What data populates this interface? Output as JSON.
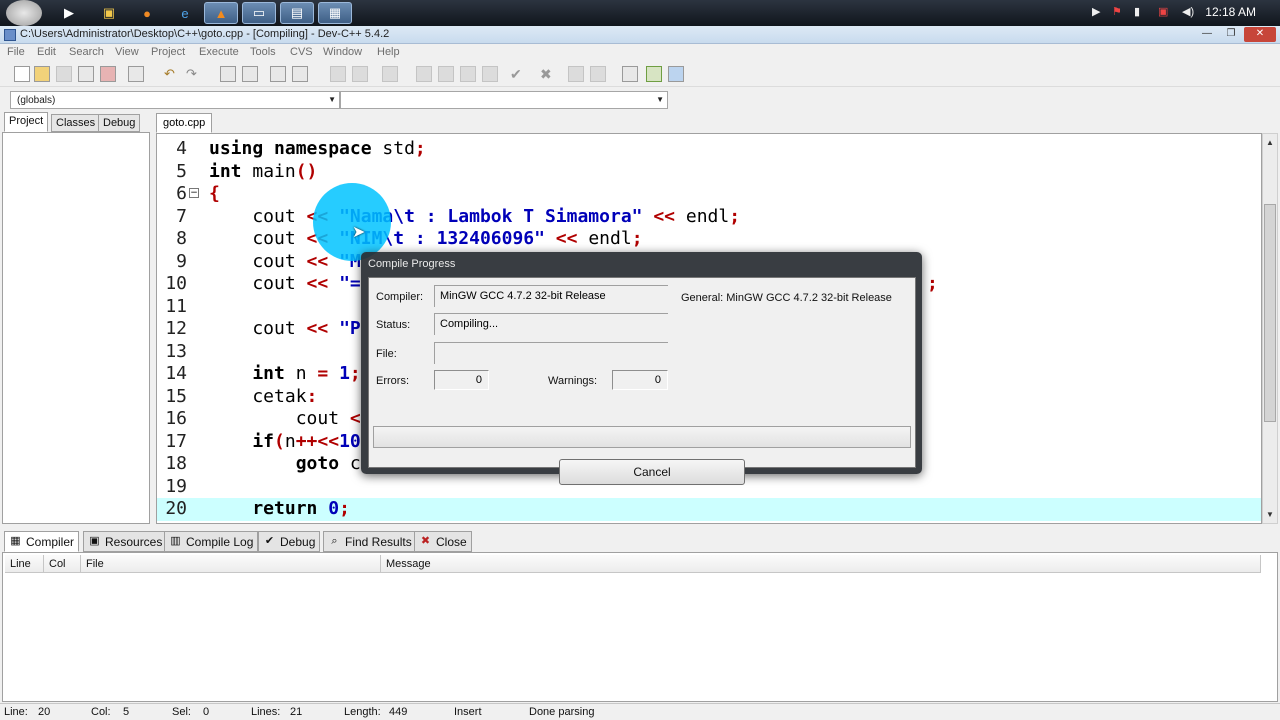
{
  "taskbar": {
    "clock": "12:18 AM",
    "buttons": [
      "start-orb",
      "media-player",
      "file-explorer",
      "firefox",
      "ie",
      "vlc",
      "window-a",
      "window-b",
      "devcpp"
    ]
  },
  "window": {
    "title": "C:\\Users\\Administrator\\Desktop\\C++\\goto.cpp - [Compiling] - Dev-C++ 5.4.2"
  },
  "menu": [
    "File",
    "Edit",
    "Search",
    "View",
    "Project",
    "Execute",
    "Tools",
    "CVS",
    "Window",
    "Help"
  ],
  "combos": {
    "scope": "(globals)",
    "members": ""
  },
  "left_tabs": [
    "Project",
    "Classes",
    "Debug"
  ],
  "editor": {
    "file_tab": "goto.cpp",
    "lines": [
      {
        "n": "4",
        "fold": false,
        "hl": false,
        "parts": [
          [
            "kw",
            "using namespace "
          ],
          [
            "id",
            "std"
          ],
          [
            "op",
            ";"
          ]
        ]
      },
      {
        "n": "5",
        "fold": false,
        "hl": false,
        "parts": [
          [
            "kw",
            "int "
          ],
          [
            "id",
            "main"
          ],
          [
            "op",
            "()"
          ]
        ]
      },
      {
        "n": "6",
        "fold": true,
        "hl": false,
        "parts": [
          [
            "op",
            "{"
          ]
        ]
      },
      {
        "n": "7",
        "fold": false,
        "hl": false,
        "parts": [
          [
            "id",
            "    cout "
          ],
          [
            "op",
            "<< "
          ],
          [
            "str",
            "\"Nama\\t : Lambok T Simamora\""
          ],
          [
            "op",
            " << "
          ],
          [
            "id",
            "endl"
          ],
          [
            "op",
            ";"
          ]
        ]
      },
      {
        "n": "8",
        "fold": false,
        "hl": false,
        "parts": [
          [
            "id",
            "    cout "
          ],
          [
            "op",
            "<< "
          ],
          [
            "str",
            "\"NIM\\t : 132406096\""
          ],
          [
            "op",
            " << "
          ],
          [
            "id",
            "endl"
          ],
          [
            "op",
            ";"
          ]
        ]
      },
      {
        "n": "9",
        "fold": false,
        "hl": false,
        "parts": [
          [
            "id",
            "    cout "
          ],
          [
            "op",
            "<< "
          ],
          [
            "str",
            "\"M"
          ]
        ]
      },
      {
        "n": "10",
        "fold": false,
        "hl": false,
        "parts": [
          [
            "id",
            "    cout "
          ],
          [
            "op",
            "<< "
          ],
          [
            "str",
            "\"="
          ]
        ]
      },
      {
        "n": "11",
        "fold": false,
        "hl": false,
        "parts": []
      },
      {
        "n": "12",
        "fold": false,
        "hl": false,
        "parts": [
          [
            "id",
            "    cout "
          ],
          [
            "op",
            "<< "
          ],
          [
            "str",
            "\"P"
          ]
        ]
      },
      {
        "n": "13",
        "fold": false,
        "hl": false,
        "parts": []
      },
      {
        "n": "14",
        "fold": false,
        "hl": false,
        "parts": [
          [
            "kw",
            "    int "
          ],
          [
            "id",
            "n "
          ],
          [
            "op",
            "= "
          ],
          [
            "num",
            "1"
          ],
          [
            "op",
            ";"
          ]
        ]
      },
      {
        "n": "15",
        "fold": false,
        "hl": false,
        "parts": [
          [
            "id",
            "    cetak"
          ],
          [
            "op",
            ":"
          ]
        ]
      },
      {
        "n": "16",
        "fold": false,
        "hl": false,
        "parts": [
          [
            "id",
            "        cout "
          ],
          [
            "op",
            "<"
          ]
        ]
      },
      {
        "n": "17",
        "fold": false,
        "hl": false,
        "parts": [
          [
            "kw",
            "    if"
          ],
          [
            "op",
            "("
          ],
          [
            "id",
            "n"
          ],
          [
            "op",
            "++<<"
          ],
          [
            "num",
            "10"
          ]
        ]
      },
      {
        "n": "18",
        "fold": false,
        "hl": false,
        "parts": [
          [
            "kw",
            "        goto "
          ],
          [
            "id",
            "c"
          ]
        ]
      },
      {
        "n": "19",
        "fold": false,
        "hl": false,
        "parts": []
      },
      {
        "n": "20",
        "fold": false,
        "hl": true,
        "parts": [
          [
            "kw",
            "    return "
          ],
          [
            "num",
            "0"
          ],
          [
            "op",
            ";"
          ]
        ]
      }
    ],
    "line10_tail": ";"
  },
  "dialog": {
    "title": "Compile Progress",
    "compiler_label": "Compiler:",
    "compiler_value": "MinGW GCC 4.7.2 32-bit Release",
    "general": "General: MinGW GCC 4.7.2 32-bit Release",
    "status_label": "Status:",
    "status_value": "Compiling...",
    "file_label": "File:",
    "file_value": "",
    "errors_label": "Errors:",
    "errors_value": "0",
    "warnings_label": "Warnings:",
    "warnings_value": "0",
    "progress": 0,
    "cancel_label": "Cancel"
  },
  "bottom_tabs": [
    {
      "label": "Compiler",
      "icon": "grid-icon"
    },
    {
      "label": "Resources",
      "icon": "resources-icon"
    },
    {
      "label": "Compile Log",
      "icon": "chart-icon"
    },
    {
      "label": "Debug",
      "icon": "check-icon"
    },
    {
      "label": "Find Results",
      "icon": "search-icon"
    },
    {
      "label": "Close",
      "icon": "close-icon"
    }
  ],
  "messages": {
    "headers": [
      "Line",
      "Col",
      "File",
      "Message"
    ]
  },
  "status": {
    "line_label": "Line:",
    "line": "20",
    "col_label": "Col:",
    "col": "5",
    "sel_label": "Sel:",
    "sel": "0",
    "lines_label": "Lines:",
    "lines": "21",
    "length_label": "Length:",
    "length": "449",
    "mode": "Insert",
    "message": "Done parsing"
  }
}
